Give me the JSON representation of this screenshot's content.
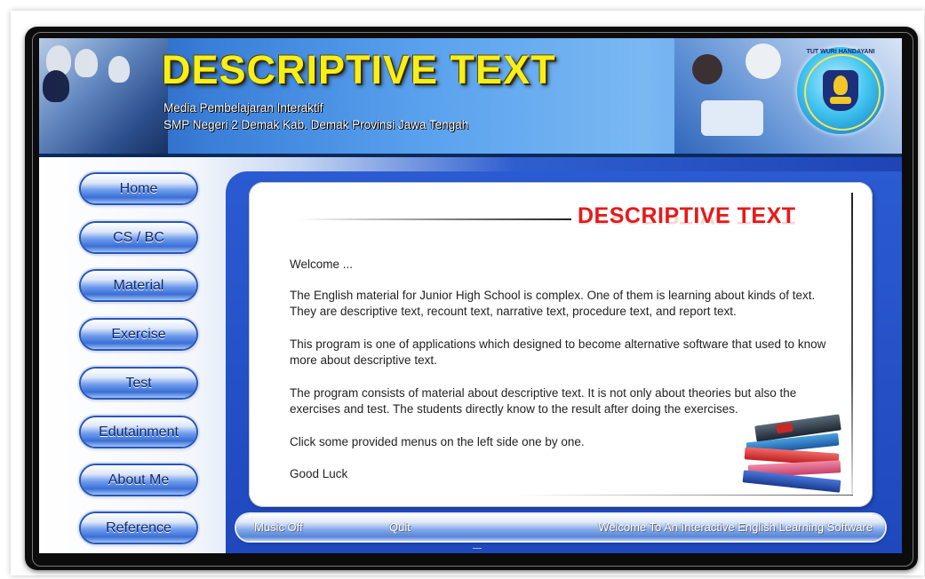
{
  "header": {
    "title": "DESCRIPTIVE TEXT",
    "subtitle_line1": "Media Pembelajaran Interaktif",
    "subtitle_line2": "SMP Negeri 2 Demak Kab. Demak Provinsi Jawa Tengah",
    "logo_motto": "TUT WURI HANDAYANI"
  },
  "nav": {
    "items": [
      {
        "label": "Home"
      },
      {
        "label": "CS / BC"
      },
      {
        "label": "Material"
      },
      {
        "label": "Exercise"
      },
      {
        "label": "Test"
      },
      {
        "label": "Edutainment"
      },
      {
        "label": "About Me"
      },
      {
        "label": "Reference"
      }
    ]
  },
  "content": {
    "title": "DESCRIPTIVE TEXT",
    "paragraphs": [
      "Welcome ...",
      "The English material for Junior High School is complex. One of them is learning about kinds of text. They are descriptive text, recount text, narrative text, procedure text, and report text.",
      "This program is one of applications which designed to become alternative software that used to know more about descriptive text.",
      "The program consists of material about descriptive text. It is not only about theories but also the exercises and test. The students directly know to the result after doing the exercises.",
      "Click some provided menus on the left side one by one.",
      "Good Luck"
    ]
  },
  "bottom_bar": {
    "music_label": "Music Off",
    "quit_label": "Quit",
    "marquee_text": "Welcome To An Interactive English Learning Software"
  },
  "colors": {
    "title_yellow": "#f6ef1a",
    "content_title_red": "#e41a1a",
    "nav_text": "#102a6a",
    "blue_accent": "#1f48bd"
  }
}
